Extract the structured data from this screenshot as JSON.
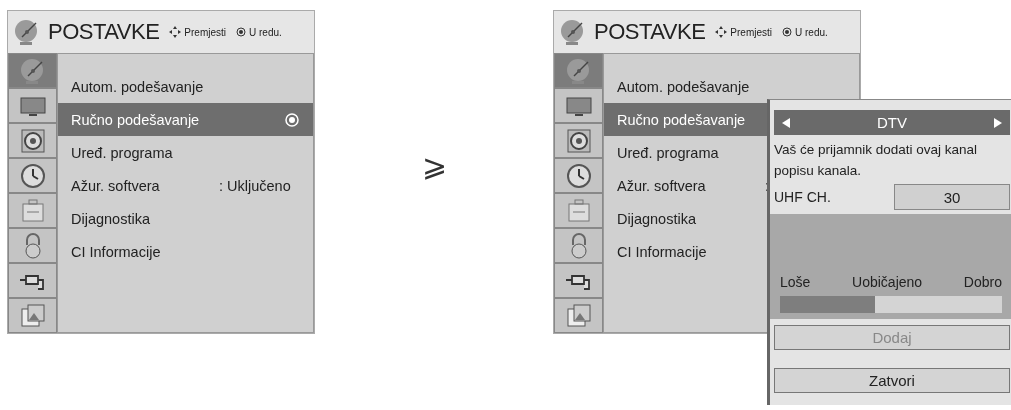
{
  "screens": [
    {
      "title": "POSTAVKE",
      "hints": [
        {
          "kind": "move",
          "label": "Premjesti"
        },
        {
          "kind": "ok",
          "label": "U redu."
        }
      ],
      "sidebar": [
        {
          "kind": "dish",
          "selected": true
        },
        {
          "kind": "tv",
          "selected": false
        },
        {
          "kind": "speaker",
          "selected": false
        },
        {
          "kind": "clock",
          "selected": false
        },
        {
          "kind": "case",
          "selected": false
        },
        {
          "kind": "lock",
          "selected": false
        },
        {
          "kind": "plug",
          "selected": false
        },
        {
          "kind": "photo",
          "selected": false
        }
      ],
      "items": [
        {
          "label": "Autom. podešavanje",
          "selected": false
        },
        {
          "label": "Ručno podešavanje",
          "selected": true,
          "ok_mark": true
        },
        {
          "label": "Uređ. programa",
          "selected": false
        },
        {
          "label": "Ažur. softvera",
          "value": ": Uključeno",
          "selected": false
        },
        {
          "label": "Dijagnostika",
          "selected": false
        },
        {
          "label": "CI Informacije",
          "selected": false
        }
      ]
    },
    {
      "title": "POSTAVKE",
      "hints": [
        {
          "kind": "move",
          "label": "Premjesti"
        },
        {
          "kind": "ok",
          "label": "U redu."
        }
      ],
      "sidebar": [
        {
          "kind": "dish",
          "selected": true
        },
        {
          "kind": "tv",
          "selected": false
        },
        {
          "kind": "speaker",
          "selected": false
        },
        {
          "kind": "clock",
          "selected": false
        },
        {
          "kind": "case",
          "selected": false
        },
        {
          "kind": "lock",
          "selected": false
        },
        {
          "kind": "plug",
          "selected": false
        },
        {
          "kind": "photo",
          "selected": false
        }
      ],
      "items": [
        {
          "label": "Autom. podešavanje",
          "selected": false
        },
        {
          "label": "Ručno podešavanje",
          "selected": true
        },
        {
          "label": "Uređ. programa",
          "selected": false
        },
        {
          "label": "Ažur. softvera",
          "value": ":",
          "selected": false
        },
        {
          "label": "Dijagnostika",
          "selected": false
        },
        {
          "label": "CI Informacije",
          "selected": false
        }
      ],
      "popup": {
        "channel_type": "DTV",
        "message": "Vaš će prijamnik dodati ovaj kanal popisu kanala.",
        "field_label": "UHF CH.",
        "field_value": "30",
        "signal_labels": [
          "Loše",
          "Uobičajeno",
          "Dobro"
        ],
        "signal": {
          "level": 0.43
        },
        "buttons": [
          {
            "label": "Dodaj",
            "disabled": true
          },
          {
            "label": "Zatvori",
            "disabled": false
          }
        ]
      }
    }
  ],
  "separator": "⩾"
}
